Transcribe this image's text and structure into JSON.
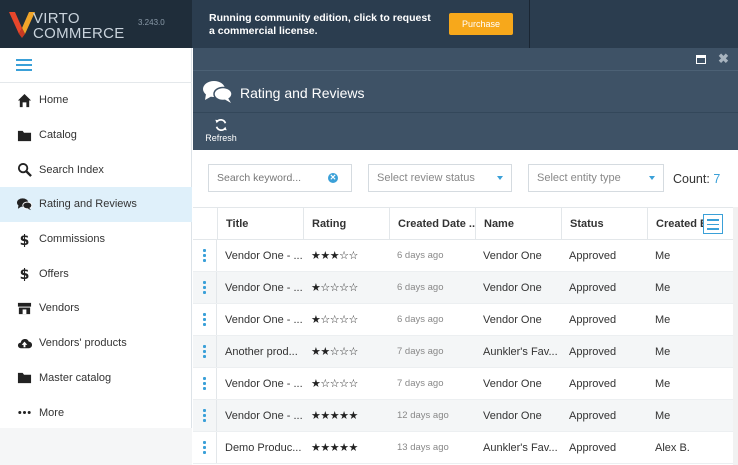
{
  "header": {
    "brand_line1": "VIRTO",
    "brand_line2": "COMMERCE",
    "version": "3.243.0",
    "promo_text": "Running community edition, click to request a commercial license.",
    "purchase_label": "Purchase",
    "colors": {
      "header_bg": "#2b3d4f",
      "accent": "#f7a81b",
      "logo": "#e8462b"
    }
  },
  "sidebar": {
    "items": [
      {
        "label": "Home",
        "icon": "home-icon"
      },
      {
        "label": "Catalog",
        "icon": "folder-icon"
      },
      {
        "label": "Search Index",
        "icon": "search-icon"
      },
      {
        "label": "Rating and Reviews",
        "icon": "comments-icon",
        "active": true
      },
      {
        "label": "Commissions",
        "icon": "dollar-icon"
      },
      {
        "label": "Offers",
        "icon": "dollar-icon"
      },
      {
        "label": "Vendors",
        "icon": "store-icon"
      },
      {
        "label": "Vendors' products",
        "icon": "cloud-upload-icon"
      },
      {
        "label": "Master catalog",
        "icon": "folder-icon"
      },
      {
        "label": "More",
        "icon": "ellipsis-icon"
      }
    ]
  },
  "blade": {
    "title": "Rating and Reviews",
    "toolbar": {
      "refresh_label": "Refresh"
    },
    "filters": {
      "search_placeholder": "Search keyword...",
      "status_placeholder": "Select review status",
      "entity_placeholder": "Select entity type",
      "count_label": "Count:",
      "count_value": "7"
    },
    "columns": [
      "Title",
      "Rating",
      "Created Date ...",
      "Name",
      "Status",
      "Created B"
    ],
    "rows": [
      {
        "title": "Vendor One - ...",
        "rating": 3,
        "created": "6 days ago",
        "name": "Vendor One",
        "status": "Approved",
        "created_by": "Me"
      },
      {
        "title": "Vendor One - ...",
        "rating": 1,
        "created": "6 days ago",
        "name": "Vendor One",
        "status": "Approved",
        "created_by": "Me"
      },
      {
        "title": "Vendor One - ...",
        "rating": 1,
        "created": "6 days ago",
        "name": "Vendor One",
        "status": "Approved",
        "created_by": "Me"
      },
      {
        "title": "Another prod...",
        "rating": 2,
        "created": "7 days ago",
        "name": "Aunkler's Fav...",
        "status": "Approved",
        "created_by": "Me"
      },
      {
        "title": "Vendor One - ...",
        "rating": 1,
        "created": "7 days ago",
        "name": "Vendor One",
        "status": "Approved",
        "created_by": "Me"
      },
      {
        "title": "Vendor One - ...",
        "rating": 5,
        "created": "12 days ago",
        "name": "Vendor One",
        "status": "Approved",
        "created_by": "Me"
      },
      {
        "title": "Demo Produc...",
        "rating": 5,
        "created": "13 days ago",
        "name": "Aunkler's Fav...",
        "status": "Approved",
        "created_by": "Alex B."
      }
    ]
  }
}
